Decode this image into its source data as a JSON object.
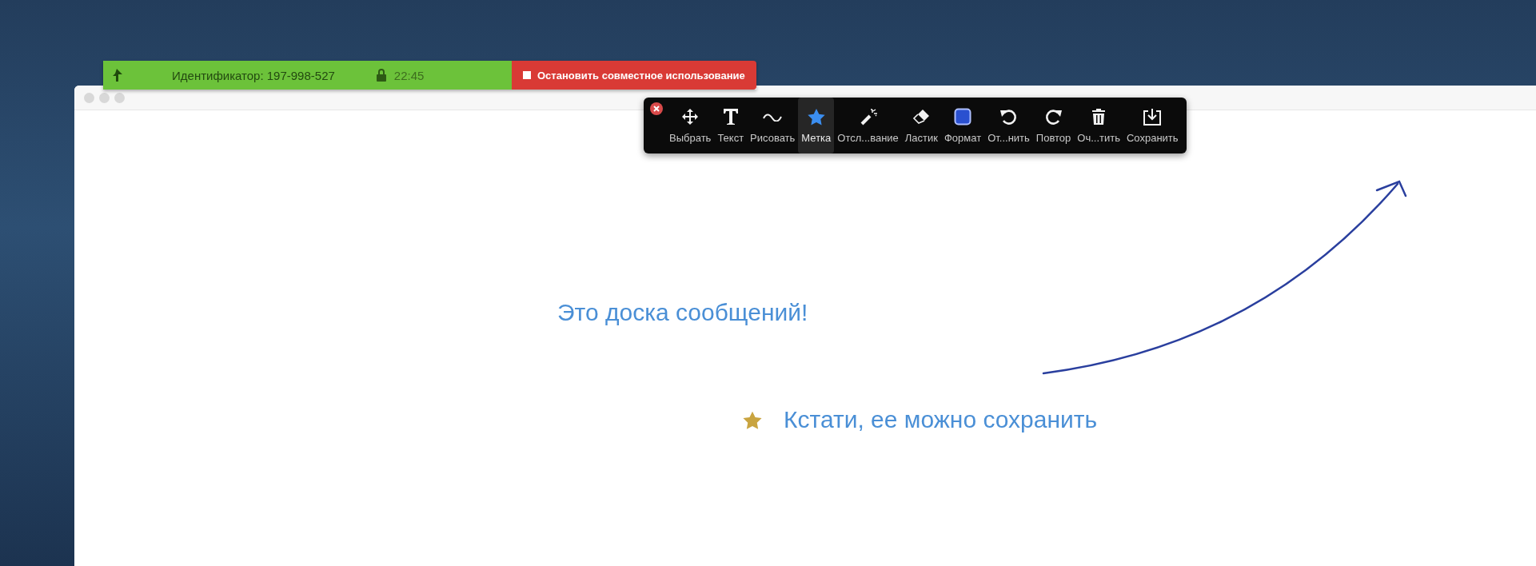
{
  "share_bar": {
    "meeting_id": "Идентификатор: 197-998-527",
    "time": "22:45",
    "stop_button": "Остановить совместное использование"
  },
  "toolbar": {
    "tools": [
      {
        "kind": "select",
        "label": "Выбрать",
        "selected": false
      },
      {
        "kind": "text",
        "label": "Текст",
        "selected": false
      },
      {
        "kind": "draw",
        "label": "Рисовать",
        "selected": false
      },
      {
        "kind": "stamp",
        "label": "Метка",
        "selected": true
      },
      {
        "kind": "spotlight",
        "label": "Отсл...вание",
        "selected": false
      },
      {
        "kind": "eraser",
        "label": "Ластик",
        "selected": false
      },
      {
        "kind": "format",
        "label": "Формат",
        "selected": false
      },
      {
        "kind": "undo",
        "label": "От...нить",
        "selected": false
      },
      {
        "kind": "redo",
        "label": "Повтор",
        "selected": false
      },
      {
        "kind": "clear",
        "label": "Оч...тить",
        "selected": false
      },
      {
        "kind": "save",
        "label": "Сохранить",
        "selected": false
      }
    ]
  },
  "whiteboard": {
    "text": "Это доска сообщений!",
    "stamp_text": "Кстати, ее можно сохранить"
  }
}
